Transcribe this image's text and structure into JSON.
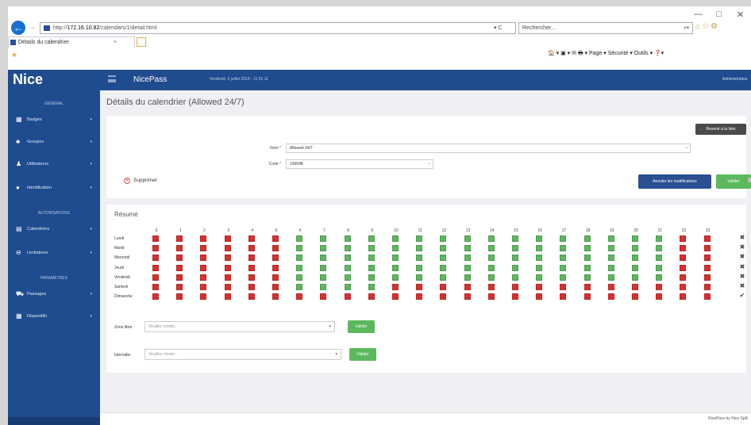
{
  "browser": {
    "address_scheme": "http://",
    "address_host": "172.16.10.82",
    "address_path": "/calendars/1/detail.html",
    "address_controls": "▾ C",
    "search_placeholder": "Rechercher...",
    "search_icon": "magnifier-icon",
    "tab_title": "Détails du calendrier",
    "tab_close": "×",
    "win_min": "—",
    "win_max": "□",
    "win_close": "✕",
    "toolbar_icons": "⌂☆⚙",
    "command_bar": "🏠 ▾ ▣ ▾ ✉ 🖶 ▾ Page ▾  Sécurité ▾  Outils ▾  ❓▾"
  },
  "app": {
    "logo": "Nice",
    "name": "NicePass",
    "date": "Vendredi, 6 juillet 2018 - 11:51:11",
    "user": "Administrateur"
  },
  "sidebar": {
    "sections": [
      {
        "label": "GÉNÉRAL"
      },
      {
        "label": "AUTORISATIONS"
      },
      {
        "label": "PARAMÈTRES"
      }
    ],
    "items": [
      {
        "icon": "▦",
        "icon_name": "badge-icon",
        "label": "Badges"
      },
      {
        "icon": "♣",
        "icon_name": "groups-icon",
        "label": "Groupes"
      },
      {
        "icon": "♟",
        "icon_name": "users-icon",
        "label": "Utilisateurs"
      },
      {
        "icon": "●",
        "icon_name": "identification-icon",
        "label": "Identification"
      },
      {
        "icon": "▤",
        "icon_name": "calendar-icon",
        "label": "Calendriers"
      },
      {
        "icon": "⊖",
        "icon_name": "limitations-icon",
        "label": "Limitations"
      },
      {
        "icon": "⛟",
        "icon_name": "passages-icon",
        "label": "Passages"
      },
      {
        "icon": "▦",
        "icon_name": "devices-icon",
        "label": "Dispositifs"
      }
    ],
    "caret": "▾"
  },
  "page": {
    "title": "Détails du calendrier (Allowed 24/7)"
  },
  "form": {
    "back_button": "Revenir à la liste",
    "name_label": "Nom *",
    "name_value": "Allowed 24/7",
    "code_label": "Code *",
    "code_value": "100048",
    "clear_glyph": "×",
    "delete_label": "Supprimer",
    "cancel_button": "Annuler les modifications",
    "save_button": "Valider"
  },
  "summary": {
    "title": "Résumé",
    "hours": [
      "0",
      "1",
      "2",
      "3",
      "4",
      "5",
      "6",
      "7",
      "8",
      "9",
      "10",
      "11",
      "12",
      "13",
      "14",
      "15",
      "16",
      "17",
      "18",
      "19",
      "20",
      "21",
      "22",
      "23"
    ],
    "days": [
      "Lundi",
      "Mardi",
      "Mercredi",
      "Jeudi",
      "Vendredi",
      "Samedi",
      "Dimanche"
    ],
    "row_markers": [
      "✖",
      "✖",
      "✖",
      "✖",
      "✖",
      "✖",
      "✔"
    ],
    "colors": {
      "allowed": "#5cb85c",
      "denied": "#d9302c"
    },
    "states": [
      [
        0,
        0,
        0,
        0,
        0,
        0,
        1,
        1,
        1,
        1,
        1,
        1,
        1,
        1,
        1,
        1,
        1,
        1,
        1,
        1,
        1,
        1,
        0,
        0
      ],
      [
        0,
        0,
        0,
        0,
        0,
        0,
        1,
        1,
        1,
        1,
        1,
        1,
        1,
        1,
        1,
        1,
        1,
        1,
        1,
        1,
        1,
        1,
        0,
        0
      ],
      [
        0,
        0,
        0,
        0,
        0,
        0,
        1,
        1,
        1,
        1,
        1,
        1,
        1,
        1,
        1,
        1,
        1,
        1,
        1,
        1,
        1,
        1,
        0,
        0
      ],
      [
        0,
        0,
        0,
        0,
        0,
        0,
        1,
        1,
        1,
        1,
        1,
        1,
        1,
        1,
        1,
        1,
        1,
        1,
        1,
        1,
        1,
        1,
        0,
        0
      ],
      [
        0,
        0,
        0,
        0,
        0,
        0,
        1,
        1,
        1,
        1,
        1,
        1,
        1,
        1,
        1,
        1,
        1,
        1,
        1,
        1,
        1,
        1,
        0,
        0
      ],
      [
        0,
        0,
        0,
        0,
        0,
        0,
        1,
        1,
        1,
        1,
        0,
        0,
        0,
        0,
        0,
        0,
        0,
        0,
        0,
        0,
        0,
        0,
        0,
        0
      ],
      [
        0,
        0,
        0,
        0,
        0,
        0,
        0,
        0,
        0,
        0,
        0,
        0,
        0,
        0,
        0,
        0,
        0,
        0,
        0,
        0,
        0,
        0,
        0,
        0
      ]
    ]
  },
  "zone": {
    "label": "Zone libre",
    "placeholder": "Veuillez choisir...",
    "button": "Valider",
    "caret": "▾"
  },
  "interval": {
    "label": "Intervalle",
    "placeholder": "Veuillez choisir...",
    "button": "Valider",
    "caret": "▾"
  },
  "footer": {
    "text": "NicePass by Nice SpA"
  }
}
